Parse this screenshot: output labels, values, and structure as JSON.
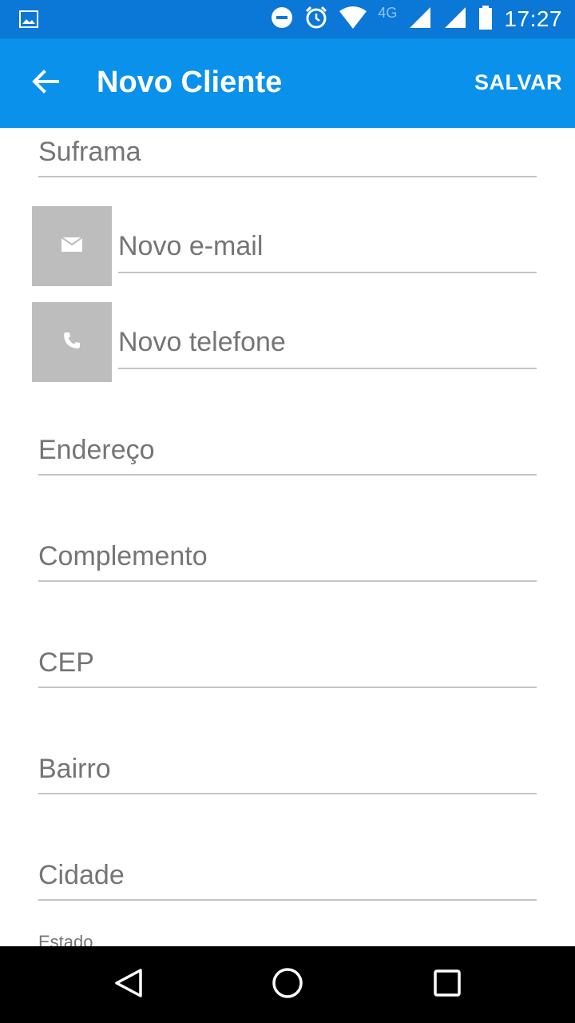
{
  "status_bar": {
    "time": "17:27",
    "network": "4G",
    "icons": [
      "image-notification-icon",
      "do-not-disturb-icon",
      "alarm-icon",
      "wifi-icon",
      "signal-icon",
      "signal-icon-2",
      "battery-icon"
    ]
  },
  "app_bar": {
    "title": "Novo Cliente",
    "save_label": "SALVAR",
    "back_icon": "arrow-left-icon"
  },
  "form": {
    "suframa": {
      "placeholder": "Suframa",
      "value": ""
    },
    "email": {
      "placeholder": "Novo e-mail",
      "value": "",
      "icon": "envelope-icon"
    },
    "phone": {
      "placeholder": "Novo telefone",
      "value": "",
      "icon": "phone-icon"
    },
    "endereco": {
      "placeholder": "Endereço",
      "value": ""
    },
    "complemento": {
      "placeholder": "Complemento",
      "value": ""
    },
    "cep": {
      "placeholder": "CEP",
      "value": ""
    },
    "bairro": {
      "placeholder": "Bairro",
      "value": ""
    },
    "cidade": {
      "placeholder": "Cidade",
      "value": ""
    },
    "estado": {
      "label": "Estado"
    }
  },
  "nav_bar": {
    "back_icon": "triangle-back-icon",
    "home_icon": "circle-home-icon",
    "recents_icon": "square-recents-icon"
  },
  "colors": {
    "status_bar": "#0b77d6",
    "app_bar": "#0a91ec",
    "icon_box": "#bdbdbd",
    "underline": "#c4c4c4",
    "placeholder_text": "#757575"
  }
}
